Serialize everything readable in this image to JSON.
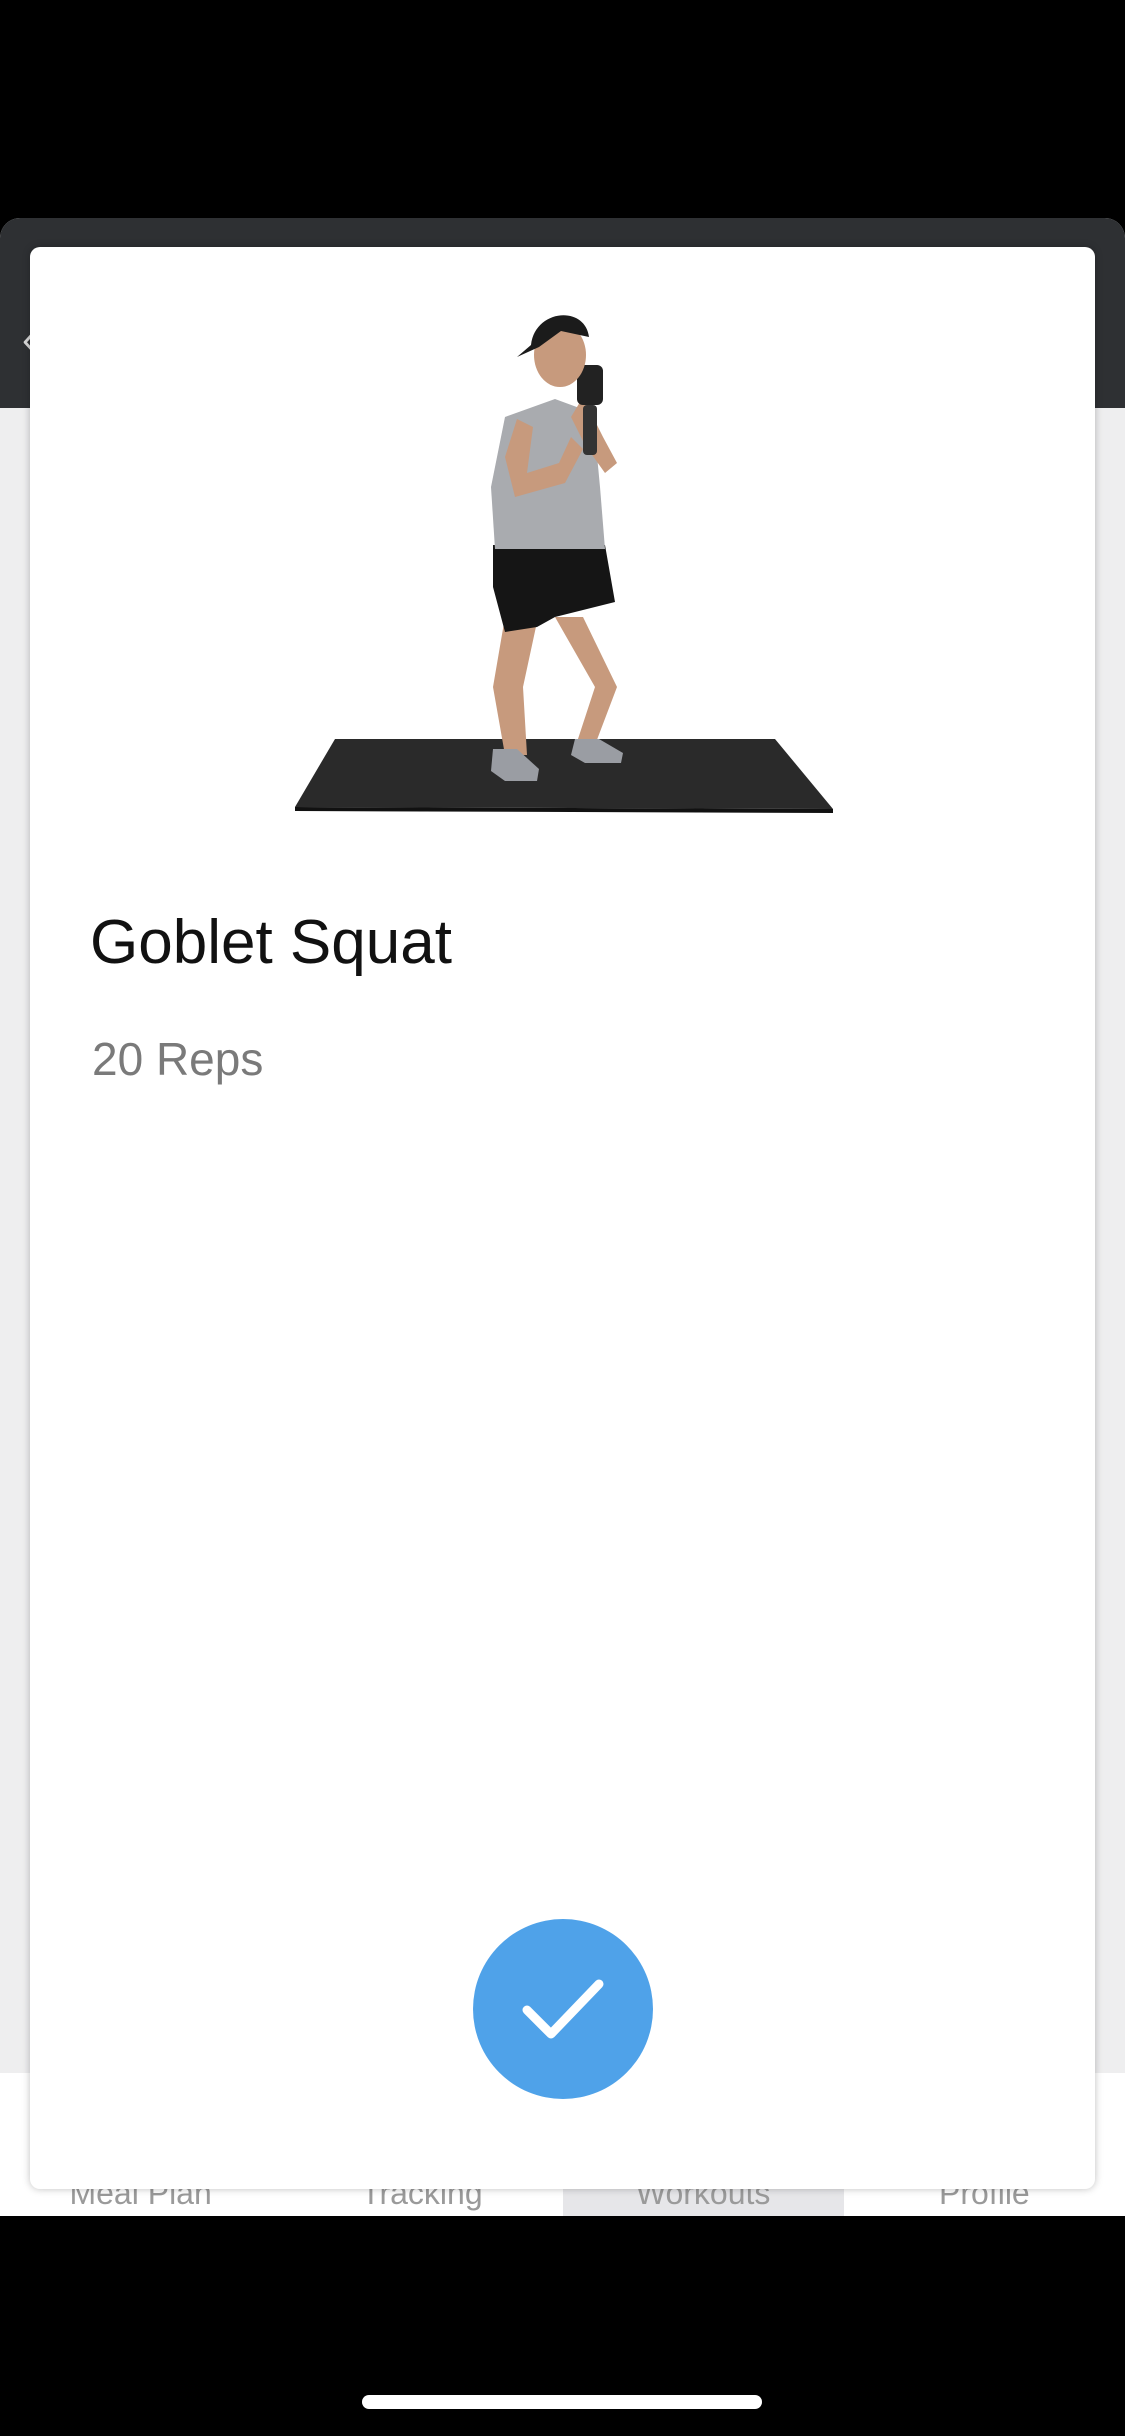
{
  "app": {
    "back_icon": "chevron-left-icon",
    "tabs": [
      {
        "label": "Meal Plan",
        "active": false
      },
      {
        "label": "Tracking",
        "active": false
      },
      {
        "label": "Workouts",
        "active": true
      },
      {
        "label": "Profile",
        "active": false
      }
    ]
  },
  "exercise": {
    "title": "Goblet Squat",
    "reps": "20 Reps",
    "image_icon": "exercise-demo-figure"
  },
  "done_button": {
    "icon": "checkmark-icon",
    "color": "#4fa2e9"
  },
  "colors": {
    "header": "#2e3033",
    "background": "#eeeeef",
    "accent": "#4fa2e9"
  }
}
